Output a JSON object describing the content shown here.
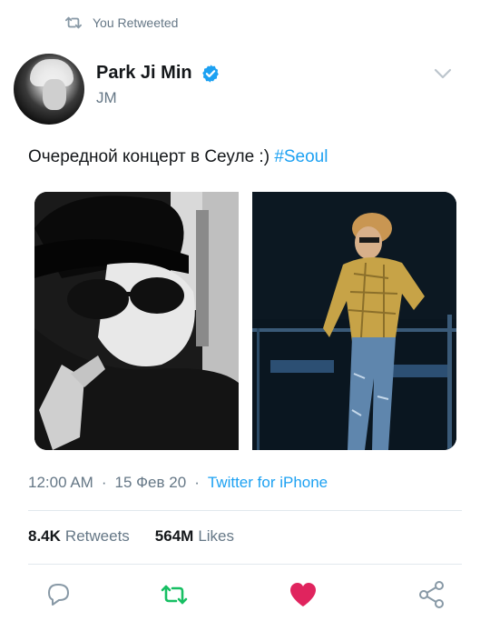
{
  "retweet_banner": {
    "label": "You Retweeted"
  },
  "author": {
    "display_name": "Park Ji Min",
    "handle": "JM",
    "verified": true
  },
  "tweet": {
    "text": "Очередной концерт в Сеуле :) ",
    "hashtag": "#Seoul"
  },
  "meta": {
    "time": "12:00 AM",
    "separator": "·",
    "date": "15 Фев 20",
    "source": "Twitter for iPhone"
  },
  "stats": {
    "retweets_count": "8.4K",
    "retweets_label": "Retweets",
    "likes_count": "564M",
    "likes_label": "Likes"
  },
  "colors": {
    "accent": "#1da1f2",
    "retweet_active": "#17bf63",
    "like_active": "#e0245e",
    "muted": "#657786"
  },
  "icons": [
    "retweet-icon",
    "verified-icon",
    "chevron-down-icon",
    "reply-icon",
    "retweet-icon",
    "heart-icon",
    "share-icon"
  ]
}
